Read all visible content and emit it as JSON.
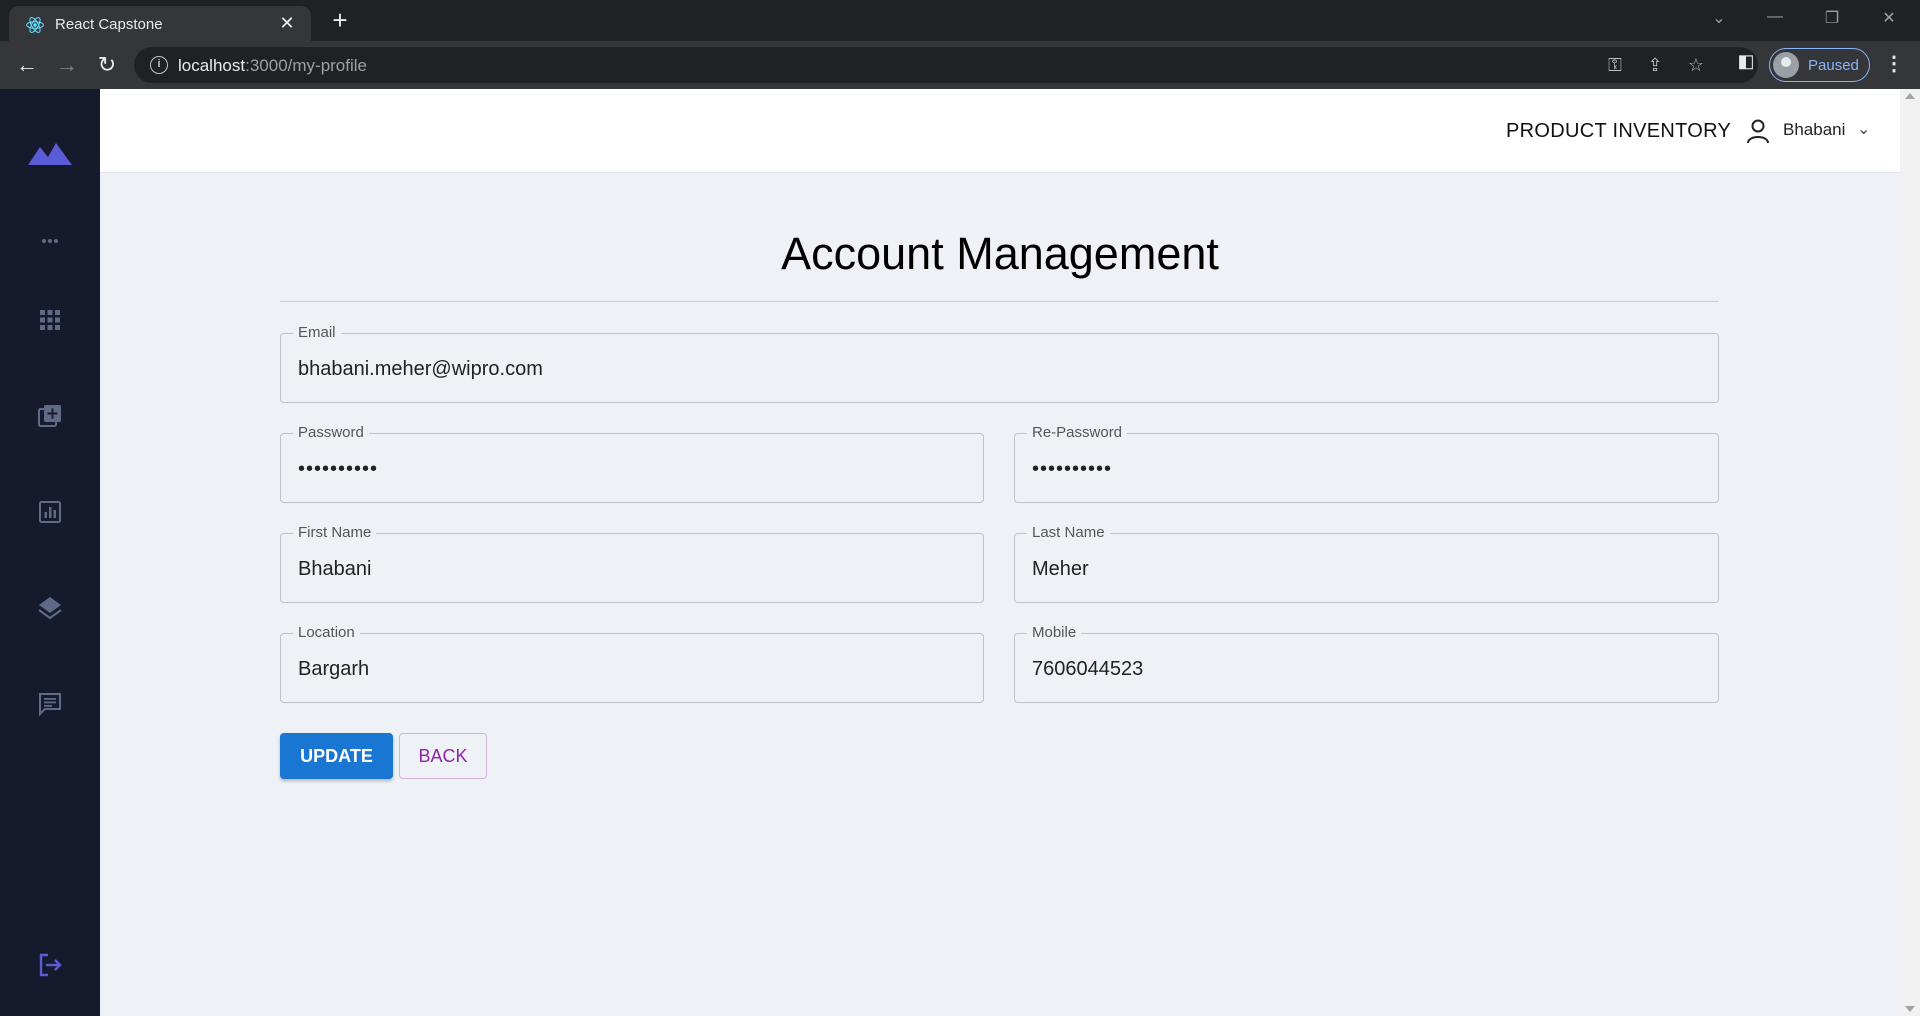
{
  "browser": {
    "tab_title": "React Capstone",
    "url_host": "localhost",
    "url_path": ":3000/my-profile",
    "profile_status": "Paused"
  },
  "header": {
    "brand": "PRODUCT INVENTORY",
    "user_name": "Bhabani"
  },
  "sidebar": {
    "items": [
      {
        "icon": "more-horizontal-icon"
      },
      {
        "icon": "apps-grid-icon"
      },
      {
        "icon": "add-to-library-icon"
      },
      {
        "icon": "analytics-icon"
      },
      {
        "icon": "layers-icon"
      },
      {
        "icon": "chat-icon"
      },
      {
        "icon": "logout-icon"
      }
    ],
    "accent": "#5b5bd6"
  },
  "page": {
    "title": "Account Management"
  },
  "form": {
    "email": {
      "label": "Email",
      "value": "bhabani.meher@wipro.com"
    },
    "password": {
      "label": "Password",
      "value": "••••••••••"
    },
    "repassword": {
      "label": "Re-Password",
      "value": "••••••••••"
    },
    "first_name": {
      "label": "First Name",
      "value": "Bhabani"
    },
    "last_name": {
      "label": "Last Name",
      "value": "Meher"
    },
    "location": {
      "label": "Location",
      "value": "Bargarh"
    },
    "mobile": {
      "label": "Mobile",
      "value": "7606044523"
    }
  },
  "buttons": {
    "update": "UPDATE",
    "back": "BACK"
  },
  "colors": {
    "primary": "#1976d2",
    "secondary": "#8e24aa",
    "sidebar_bg": "#161a2d",
    "page_bg": "#eef1f6"
  }
}
